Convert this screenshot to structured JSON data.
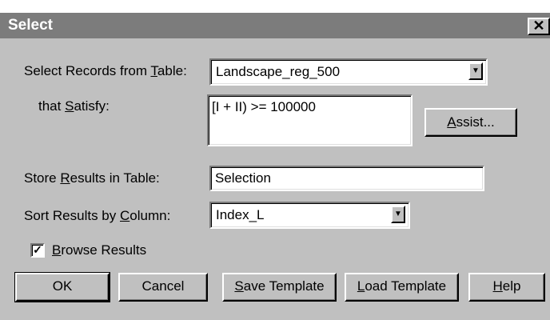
{
  "window": {
    "title": "Select",
    "close_glyph": "✕"
  },
  "form": {
    "table_label_pre": "Select Records from ",
    "table_label_ul": "T",
    "table_label_post": "able:",
    "table_value": "Landscape_reg_500",
    "satisfy_label_pre": "that ",
    "satisfy_label_ul": "S",
    "satisfy_label_post": "atisfy:",
    "satisfy_value": "[I + II) >= 100000",
    "store_label_pre": "Store ",
    "store_label_ul": "R",
    "store_label_post": "esults in Table:",
    "store_value": "Selection",
    "sort_label_pre": "Sort Results by ",
    "sort_label_ul": "C",
    "sort_label_post": "olumn:",
    "sort_value": "Index_L",
    "browse_checked": true,
    "browse_check_glyph": "✓",
    "browse_label_ul": "B",
    "browse_label_post": "rowse Results"
  },
  "buttons": {
    "assist_ul": "A",
    "assist_post": "ssist...",
    "ok": "OK",
    "cancel": "Cancel",
    "save_ul": "S",
    "save_post": "ave Template",
    "load_ul": "L",
    "load_post": "oad Template",
    "help_ul": "H",
    "help_post": "elp"
  },
  "icons": {
    "dropdown_arrow": "▼"
  }
}
